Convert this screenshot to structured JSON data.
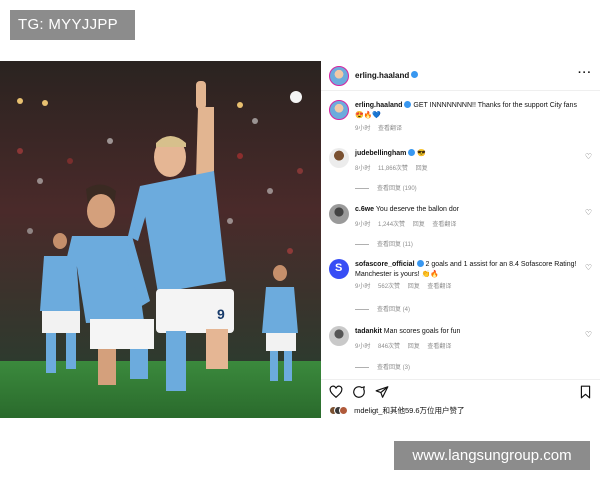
{
  "watermarks": {
    "top": "TG: MYYJJPP",
    "bottom": "www.langsungroup.com"
  },
  "post": {
    "author": "erling.haaland",
    "more_label": "···",
    "caption": {
      "user": "erling.haaland",
      "text": "GET INNNNNNNN!! Thanks for the support City fans 😍🔥💙",
      "time": "9小时",
      "translate": "查看翻译"
    },
    "comments": [
      {
        "user": "judebellingham",
        "text": "😎",
        "time": "8小时",
        "likes": "11,866次赞",
        "reply": "回复",
        "view_replies": "查看回复 (190)"
      },
      {
        "user": "c.6we",
        "text": "You deserve the ballon dor",
        "time": "9小时",
        "likes": "1,244次赞",
        "reply": "回复",
        "translate": "查看翻译",
        "view_replies": "查看回复 (11)"
      },
      {
        "user": "sofascore_official",
        "text": "2 goals and 1 assist for an 8.4 Sofascore Rating! Manchester is yours! 👏🔥",
        "time": "9小时",
        "likes": "562次赞",
        "reply": "回复",
        "translate": "查看翻译",
        "view_replies": "查看回复 (4)"
      },
      {
        "user": "tadankit",
        "text": "Man scores goals for fun",
        "time": "9小时",
        "likes": "846次赞",
        "reply": "回复",
        "translate": "查看翻译",
        "view_replies": "查看回复 (3)"
      }
    ],
    "likes_line": "mdeligt_和其他59.6万位用户赞了",
    "photo_icons": [
      "heart-icon",
      "comment-icon",
      "share-icon",
      "bookmark-icon"
    ],
    "colors": {
      "city_blue": "#6cabdd",
      "verified": "#3897f0",
      "pitch": "#2f7a33"
    }
  }
}
